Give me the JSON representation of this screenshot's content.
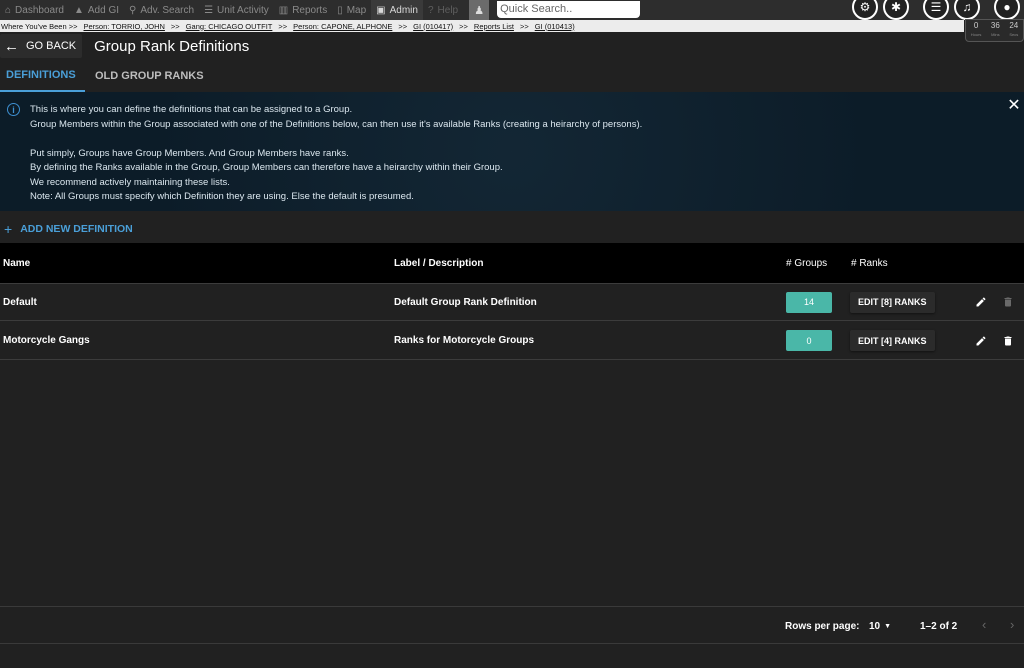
{
  "nav": {
    "items": [
      {
        "icon": "home-icon",
        "glyph": "⌂",
        "label": "Dashboard"
      },
      {
        "icon": "add-icon",
        "glyph": "▲",
        "label": "Add GI"
      },
      {
        "icon": "search-icon",
        "glyph": "⚲",
        "label": "Adv. Search"
      },
      {
        "icon": "list-icon",
        "glyph": "☰",
        "label": "Unit Activity"
      },
      {
        "icon": "chart-icon",
        "glyph": "▥",
        "label": "Reports"
      },
      {
        "icon": "map-icon",
        "glyph": "▯",
        "label": "Map"
      },
      {
        "icon": "lock-icon",
        "glyph": "▣",
        "label": "Admin"
      },
      {
        "icon": "help-icon",
        "glyph": "?",
        "label": "Help"
      }
    ],
    "search_placeholder": "Quick Search.."
  },
  "breadcrumb": {
    "prefix": "Where You've Been >>",
    "links": [
      "Person: TORRIO, JOHN",
      "Gang: CHICAGO OUTFIT",
      "Person: CAPONE, ALPHONE",
      "GI (010417)",
      "Reports List",
      "GI (010413)"
    ],
    "separator": ">>"
  },
  "timer": {
    "values": [
      {
        "num": "0",
        "label": "Hours"
      },
      {
        "num": "36",
        "label": "Mins"
      },
      {
        "num": "24",
        "label": "Secs"
      }
    ]
  },
  "header": {
    "back_label": "GO BACK",
    "title": "Group Rank Definitions"
  },
  "tabs": {
    "definitions": "DEFINITIONS",
    "old_ranks": "OLD GROUP RANKS"
  },
  "info": {
    "line1": "This is where you can define the definitions that can be assigned to a Group.",
    "line2": "Group Members within the Group associated with one of the Definitions below, can then use it's available Ranks (creating a heirarchy of persons).",
    "line3": "Put simply, Groups have Group Members. And Group Members have ranks.",
    "line4": "By defining the Ranks available in the Group, Group Members can therefore have a heirarchy within their Group.",
    "line5": "We recommend actively maintaining these lists.",
    "line6": "Note: All Groups must specify which Definition they are using. Else the default is presumed."
  },
  "add_new_label": "ADD NEW DEFINITION",
  "table": {
    "headers": {
      "name": "Name",
      "label": "Label / Description",
      "groups": "# Groups",
      "ranks": "# Ranks"
    },
    "rows": [
      {
        "name": "Default",
        "label": "Default Group Rank Definition",
        "groups": "14",
        "ranks_button": "EDIT [8] RANKS"
      },
      {
        "name": "Motorcycle Gangs",
        "label": "Ranks for Motorcycle Groups",
        "groups": "0",
        "ranks_button": "EDIT [4] RANKS"
      }
    ]
  },
  "pagination": {
    "rows_per_page_label": "Rows per page:",
    "rows_per_page": "10",
    "range": "1–2 of 2"
  },
  "colors": {
    "accent": "#4a9fd8",
    "badge": "#4ab7a8",
    "info_bg": "#0c1c28"
  }
}
